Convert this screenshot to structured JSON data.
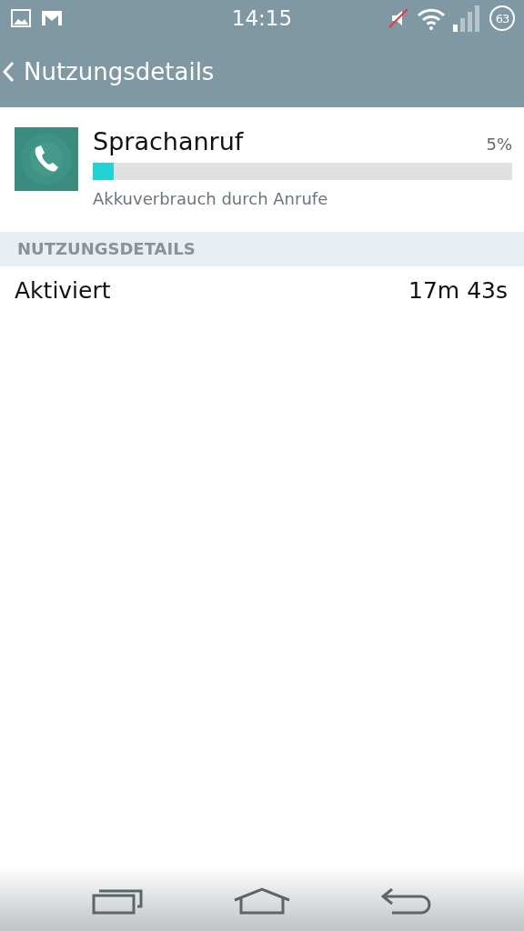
{
  "status_bar": {
    "time": "14:15",
    "battery": "63"
  },
  "action_bar": {
    "title": "Nutzungsdetails"
  },
  "app": {
    "name": "Sprachanruf",
    "percent": "5%",
    "level": 0.05,
    "description": "Akkuverbrauch durch Anrufe"
  },
  "section": {
    "title": "NUTZUNGSDETAILS",
    "rows": [
      {
        "label": "Aktiviert",
        "value": "17m 43s"
      }
    ]
  }
}
